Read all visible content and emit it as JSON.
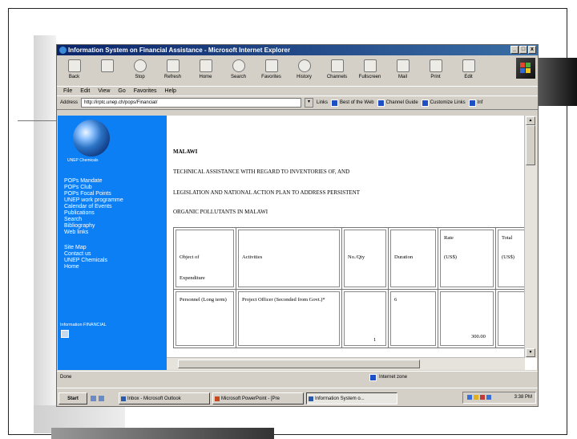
{
  "window": {
    "title": "Information System on Financial Assistance - Microsoft Internet Explorer",
    "controls": [
      "_",
      "□",
      "x"
    ]
  },
  "toolbar": {
    "buttons": [
      "Back",
      "",
      "Stop",
      "Refresh",
      "Home",
      "Search",
      "Favorites",
      "History",
      "Channels",
      "Fullscreen",
      "Mail",
      "Print",
      "Edit"
    ]
  },
  "menu": [
    "File",
    "Edit",
    "View",
    "Go",
    "Favorites",
    "Help"
  ],
  "address": {
    "label": "Address",
    "value": "http://irptc.unep.ch/pops/Financial/",
    "links_label": "Links",
    "links": [
      "Best of the Web",
      "Channel Guide",
      "Customize Links",
      "Inf"
    ]
  },
  "sidebar": {
    "caption": "UNEP Chemicals",
    "nav_group_1": [
      "POPs Mandate",
      "POPs Club",
      "POPs Focal Points",
      "UNEP work programme",
      "Calendar of Events",
      "Publications",
      "Search",
      "Bibliography",
      "Web links"
    ],
    "nav_group_2": [
      "Site Map",
      "Contact us",
      "UNEP Chemicals",
      "Home"
    ],
    "bottom_link": "Information FINANCIAL"
  },
  "document": {
    "title": "MALAWI",
    "lines": [
      "TECHNICAL ASSISTANCE WITH REGARD TO INVENTORIES OF, AND",
      "LEGISLATION AND NATIONAL ACTION PLAN TO ADDRESS PERSISTENT",
      "ORGANIC POLLUTANTS IN MALAWI"
    ],
    "table": {
      "headers": [
        {
          "lines": [
            "Object of",
            "Expenditure"
          ]
        },
        {
          "lines": [
            "Activities"
          ]
        },
        {
          "lines": [
            "No./Qty"
          ]
        },
        {
          "lines": [
            "Duration"
          ]
        },
        {
          "lines": [
            "Rate",
            "(US$)"
          ]
        },
        {
          "lines": [
            "Total",
            "(US$)"
          ]
        }
      ],
      "row1": [
        "Personnel (Long term)",
        "Project Officer (Seconded from Govt.)*",
        "1",
        "6",
        "300.00",
        ""
      ]
    }
  },
  "status": {
    "left": "Done",
    "zone": "Internet zone"
  },
  "taskbar": {
    "start": "Start",
    "tasks": [
      "Inbox - Microsoft Outlook",
      "Microsoft PowerPoint - [Pre",
      "Information System o..."
    ],
    "clock": "3:38 PM"
  }
}
